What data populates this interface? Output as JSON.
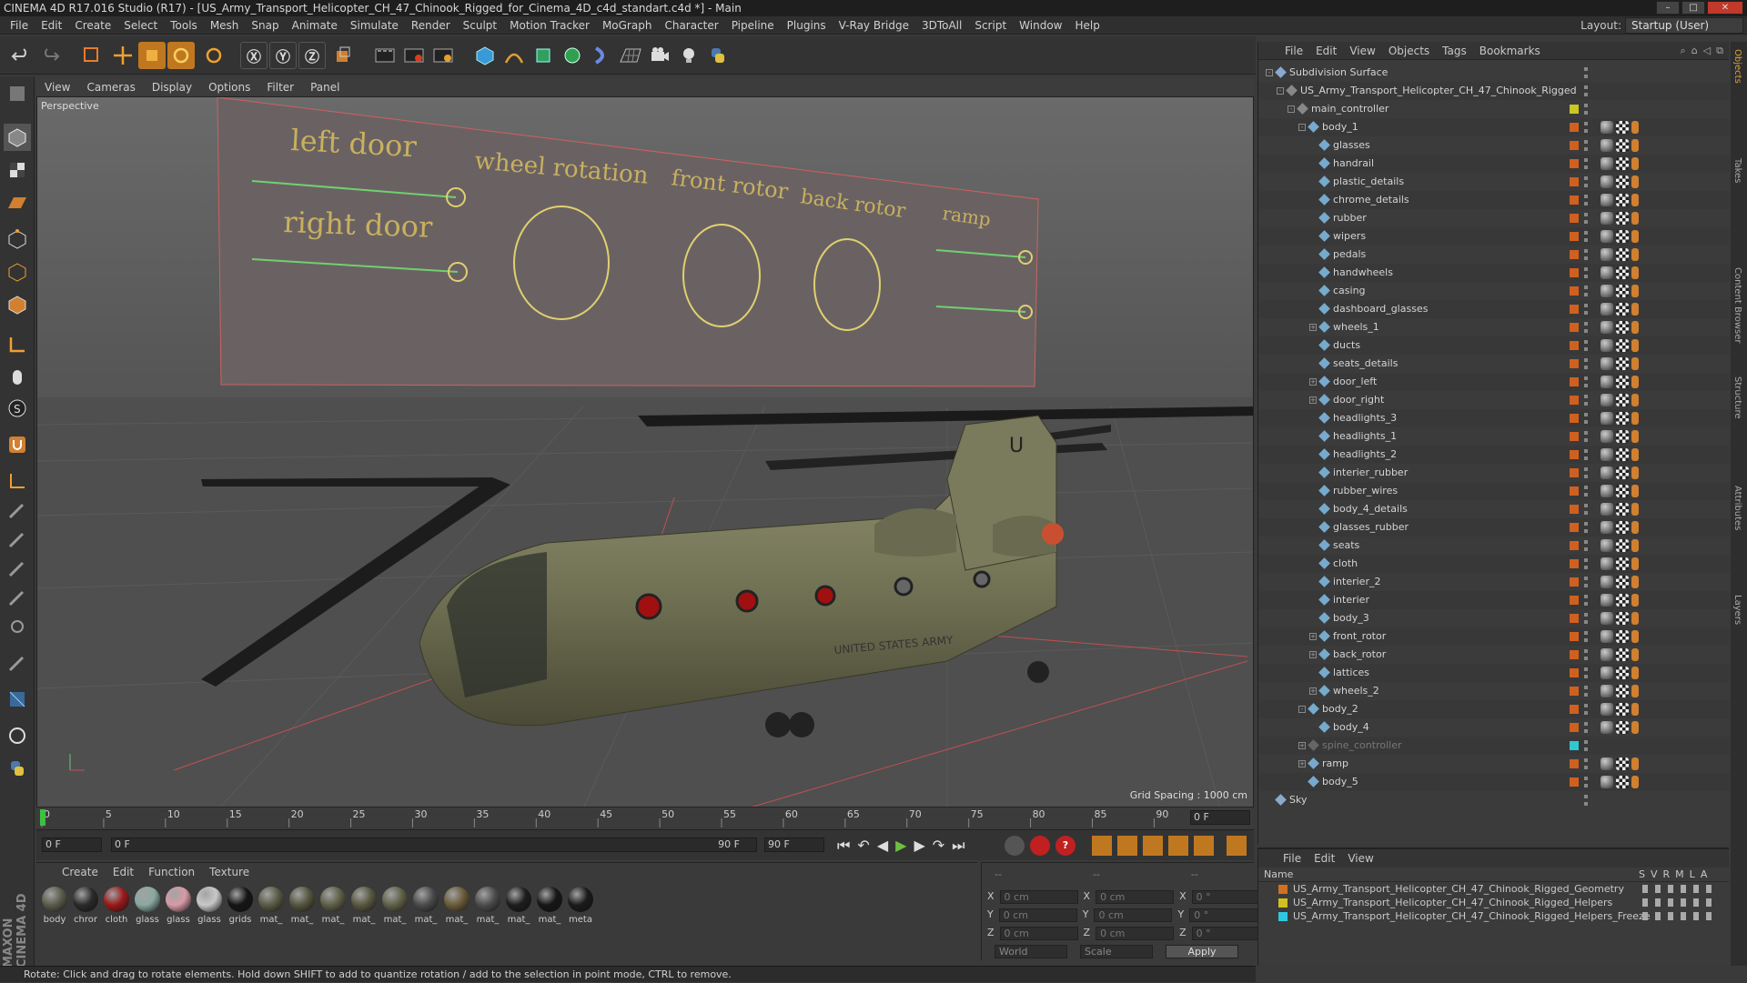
{
  "window": {
    "title": "CINEMA 4D R17.016 Studio (R17) - [US_Army_Transport_Helicopter_CH_47_Chinook_Rigged_for_Cinema_4D_c4d_standart.c4d *] - Main"
  },
  "menubar": [
    "File",
    "Edit",
    "Create",
    "Select",
    "Tools",
    "Mesh",
    "Snap",
    "Animate",
    "Simulate",
    "Render",
    "Sculpt",
    "Motion Tracker",
    "MoGraph",
    "Character",
    "Pipeline",
    "Plugins",
    "V-Ray Bridge",
    "3DToAll",
    "Script",
    "Window",
    "Help"
  ],
  "layout": {
    "label": "Layout:",
    "value": "Startup (User)"
  },
  "viewport": {
    "menu": [
      "View",
      "Cameras",
      "Display",
      "Options",
      "Filter",
      "Panel"
    ],
    "camera": "Perspective",
    "grid_spacing": "Grid Spacing : 1000 cm",
    "controller_labels": [
      "left door",
      "right door",
      "wheel rotation",
      "front rotor",
      "back rotor",
      "ramp"
    ],
    "fuselage_text": "UNITED STATES ARMY",
    "tail_letter": "U"
  },
  "timeline": {
    "ticks": [
      "0",
      "5",
      "10",
      "15",
      "20",
      "25",
      "30",
      "35",
      "40",
      "45",
      "50",
      "55",
      "60",
      "65",
      "70",
      "75",
      "80",
      "85",
      "90"
    ],
    "end_field": "0 F",
    "start_field": "0 F",
    "range_start": "0 F",
    "range_end": "90 F",
    "max_field": "90 F"
  },
  "materials": {
    "menu": [
      "Create",
      "Edit",
      "Function",
      "Texture"
    ],
    "items": [
      {
        "name": "body",
        "color": "#5b5b4c"
      },
      {
        "name": "chror",
        "color": "#2a2a2a"
      },
      {
        "name": "cloth",
        "color": "#9a1a1a"
      },
      {
        "name": "glass",
        "color": "#8aa8a0"
      },
      {
        "name": "glass",
        "color": "#d79aa5"
      },
      {
        "name": "glass",
        "color": "#c8c8c8"
      },
      {
        "name": "grids",
        "color": "#151515"
      },
      {
        "name": "mat_",
        "color": "#5a5a45"
      },
      {
        "name": "mat_",
        "color": "#55553f"
      },
      {
        "name": "mat_",
        "color": "#5f5f48"
      },
      {
        "name": "mat_",
        "color": "#58583f"
      },
      {
        "name": "mat_",
        "color": "#606048"
      },
      {
        "name": "mat_",
        "color": "#4a4a4a"
      },
      {
        "name": "mat_",
        "color": "#6a5a38"
      },
      {
        "name": "mat_",
        "color": "#4c4c4c"
      },
      {
        "name": "mat_",
        "color": "#1d1d1d"
      },
      {
        "name": "mat_",
        "color": "#161616"
      },
      {
        "name": "meta",
        "color": "#1a1a1a"
      }
    ]
  },
  "coordinates": {
    "headers": [
      "--",
      "--",
      "--"
    ],
    "rows": [
      {
        "a": "X",
        "av": "0 cm",
        "b": "X",
        "bv": "0 cm",
        "c": "X",
        "cv": "0 °"
      },
      {
        "a": "Y",
        "av": "0 cm",
        "b": "Y",
        "bv": "0 cm",
        "c": "Y",
        "cv": "0 °"
      },
      {
        "a": "Z",
        "av": "0 cm",
        "b": "Z",
        "bv": "0 cm",
        "c": "Z",
        "cv": "0 °"
      }
    ],
    "world": "World",
    "scale": "Scale",
    "apply": "Apply"
  },
  "status": "Rotate: Click and drag to rotate elements. Hold down SHIFT to add to quantize rotation / add to the selection in point mode, CTRL to remove.",
  "objects": {
    "menu": [
      "File",
      "Edit",
      "View",
      "Objects",
      "Tags",
      "Bookmarks"
    ],
    "tree": [
      {
        "name": "Subdivision Surface",
        "level": 0,
        "color": "#8ac",
        "exp": "-"
      },
      {
        "name": "US_Army_Transport_Helicopter_CH_47_Chinook_Rigged",
        "level": 1,
        "color": "#888",
        "exp": "-"
      },
      {
        "name": "main_controller",
        "level": 2,
        "color": "#888",
        "exp": "-",
        "sq": "#c8c820"
      },
      {
        "name": "body_1",
        "level": 3,
        "color": "#7ac",
        "exp": "-",
        "sq": "#d06020"
      },
      {
        "name": "glasses",
        "level": 4,
        "color": "#7ac",
        "sq": "#d06020"
      },
      {
        "name": "handrail",
        "level": 4,
        "color": "#7ac",
        "sq": "#d06020"
      },
      {
        "name": "plastic_details",
        "level": 4,
        "color": "#7ac",
        "sq": "#d06020"
      },
      {
        "name": "chrome_details",
        "level": 4,
        "color": "#7ac",
        "sq": "#d06020"
      },
      {
        "name": "rubber",
        "level": 4,
        "color": "#7ac",
        "sq": "#d06020"
      },
      {
        "name": "wipers",
        "level": 4,
        "color": "#7ac",
        "sq": "#d06020"
      },
      {
        "name": "pedals",
        "level": 4,
        "color": "#7ac",
        "sq": "#d06020"
      },
      {
        "name": "handwheels",
        "level": 4,
        "color": "#7ac",
        "sq": "#d06020"
      },
      {
        "name": "casing",
        "level": 4,
        "color": "#7ac",
        "sq": "#d06020"
      },
      {
        "name": "dashboard_glasses",
        "level": 4,
        "color": "#7ac",
        "sq": "#d06020"
      },
      {
        "name": "wheels_1",
        "level": 4,
        "color": "#7ac",
        "exp": "+",
        "sq": "#d06020"
      },
      {
        "name": "ducts",
        "level": 4,
        "color": "#7ac",
        "sq": "#d06020"
      },
      {
        "name": "seats_details",
        "level": 4,
        "color": "#7ac",
        "sq": "#d06020"
      },
      {
        "name": "door_left",
        "level": 4,
        "color": "#7ac",
        "exp": "+",
        "sq": "#d06020"
      },
      {
        "name": "door_right",
        "level": 4,
        "color": "#7ac",
        "exp": "+",
        "sq": "#d06020"
      },
      {
        "name": "headlights_3",
        "level": 4,
        "color": "#7ac",
        "sq": "#d06020"
      },
      {
        "name": "headlights_1",
        "level": 4,
        "color": "#7ac",
        "sq": "#d06020"
      },
      {
        "name": "headlights_2",
        "level": 4,
        "color": "#7ac",
        "sq": "#d06020"
      },
      {
        "name": "interier_rubber",
        "level": 4,
        "color": "#7ac",
        "sq": "#d06020"
      },
      {
        "name": "rubber_wires",
        "level": 4,
        "color": "#7ac",
        "sq": "#d06020"
      },
      {
        "name": "body_4_details",
        "level": 4,
        "color": "#7ac",
        "sq": "#d06020"
      },
      {
        "name": "glasses_rubber",
        "level": 4,
        "color": "#7ac",
        "sq": "#d06020"
      },
      {
        "name": "seats",
        "level": 4,
        "color": "#7ac",
        "sq": "#d06020"
      },
      {
        "name": "cloth",
        "level": 4,
        "color": "#7ac",
        "sq": "#d06020"
      },
      {
        "name": "interier_2",
        "level": 4,
        "color": "#7ac",
        "sq": "#d06020"
      },
      {
        "name": "interier",
        "level": 4,
        "color": "#7ac",
        "sq": "#d06020"
      },
      {
        "name": "body_3",
        "level": 4,
        "color": "#7ac",
        "sq": "#d06020"
      },
      {
        "name": "front_rotor",
        "level": 4,
        "color": "#7ac",
        "exp": "+",
        "sq": "#d06020"
      },
      {
        "name": "back_rotor",
        "level": 4,
        "color": "#7ac",
        "exp": "+",
        "sq": "#d06020"
      },
      {
        "name": "lattices",
        "level": 4,
        "color": "#7ac",
        "sq": "#d06020"
      },
      {
        "name": "wheels_2",
        "level": 4,
        "color": "#7ac",
        "exp": "+",
        "sq": "#d06020"
      },
      {
        "name": "body_2",
        "level": 3,
        "color": "#7ac",
        "exp": "-",
        "sq": "#d06020"
      },
      {
        "name": "body_4",
        "level": 4,
        "color": "#7ac",
        "sq": "#d06020"
      },
      {
        "name": "spine_controller",
        "level": 3,
        "color": "#666",
        "exp": "+",
        "sq": "#30c8d0",
        "dim": true
      },
      {
        "name": "ramp",
        "level": 3,
        "color": "#7ac",
        "exp": "+",
        "sq": "#d06020"
      },
      {
        "name": "body_5",
        "level": 3,
        "color": "#7ac",
        "sq": "#d06020"
      },
      {
        "name": "Sky",
        "level": 0,
        "color": "#8ac"
      }
    ]
  },
  "layers": {
    "menu": [
      "File",
      "Edit",
      "View"
    ],
    "col_name": "Name",
    "cols": [
      "S",
      "V",
      "R",
      "M",
      "L",
      "A"
    ],
    "items": [
      {
        "name": "US_Army_Transport_Helicopter_CH_47_Chinook_Rigged_Geometry",
        "color": "#d07020"
      },
      {
        "name": "US_Army_Transport_Helicopter_CH_47_Chinook_Rigged_Helpers",
        "color": "#d0c020"
      },
      {
        "name": "US_Army_Transport_Helicopter_CH_47_Chinook_Rigged_Helpers_Freeze",
        "color": "#30c8e0"
      }
    ]
  },
  "sidetabs": [
    "Objects",
    "Takes",
    "Content Browser",
    "Structure",
    "Attributes",
    "Layers"
  ],
  "brand": "MAXON CINEMA 4D"
}
